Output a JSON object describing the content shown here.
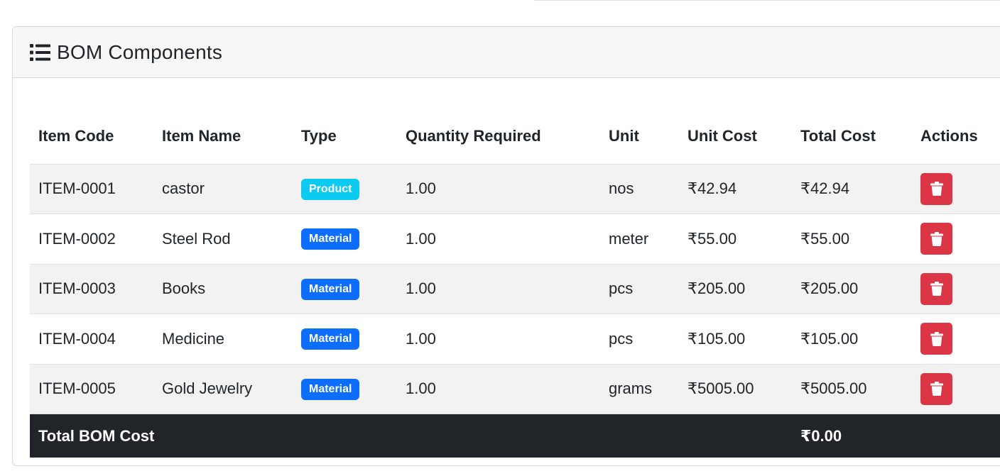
{
  "card": {
    "title": "BOM Components",
    "icon": "list-icon"
  },
  "table": {
    "headers": {
      "item_code": "Item Code",
      "item_name": "Item Name",
      "type": "Type",
      "quantity": "Quantity Required",
      "unit": "Unit",
      "unit_cost": "Unit Cost",
      "total_cost": "Total Cost",
      "actions": "Actions"
    },
    "rows": [
      {
        "code": "ITEM-0001",
        "name": "castor",
        "type": "Product",
        "qty": "1.00",
        "unit": "nos",
        "unit_cost": "₹42.94",
        "total_cost": "₹42.94"
      },
      {
        "code": "ITEM-0002",
        "name": "Steel Rod",
        "type": "Material",
        "qty": "1.00",
        "unit": "meter",
        "unit_cost": "₹55.00",
        "total_cost": "₹55.00"
      },
      {
        "code": "ITEM-0003",
        "name": "Books",
        "type": "Material",
        "qty": "1.00",
        "unit": "pcs",
        "unit_cost": "₹205.00",
        "total_cost": "₹205.00"
      },
      {
        "code": "ITEM-0004",
        "name": "Medicine",
        "type": "Material",
        "qty": "1.00",
        "unit": "pcs",
        "unit_cost": "₹105.00",
        "total_cost": "₹105.00"
      },
      {
        "code": "ITEM-0005",
        "name": "Gold Jewelry",
        "type": "Material",
        "qty": "1.00",
        "unit": "grams",
        "unit_cost": "₹5005.00",
        "total_cost": "₹5005.00"
      }
    ],
    "footer": {
      "label": "Total BOM Cost",
      "value": "₹0.00"
    }
  },
  "colors": {
    "product_badge": "#0dcaf0",
    "material_badge": "#0d6efd",
    "delete_button": "#dc3545",
    "footer_bg": "#212529"
  },
  "icons": {
    "delete": "trash-icon"
  }
}
